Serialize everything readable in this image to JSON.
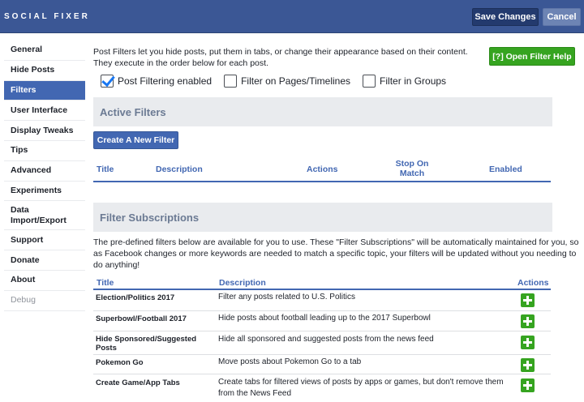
{
  "header": {
    "brand": "SOCIAL FIXER",
    "save_label": "Save Changes",
    "cancel_label": "Cancel"
  },
  "sidebar": {
    "items": [
      {
        "label": "General"
      },
      {
        "label": "Hide Posts"
      },
      {
        "label": "Filters"
      },
      {
        "label": "User Interface"
      },
      {
        "label": "Display Tweaks"
      },
      {
        "label": "Tips"
      },
      {
        "label": "Advanced"
      },
      {
        "label": "Experiments"
      },
      {
        "label": "Data Import/Export"
      },
      {
        "label": "Support"
      },
      {
        "label": "Donate"
      },
      {
        "label": "About"
      },
      {
        "label": "Debug"
      }
    ],
    "active_index": 2
  },
  "main": {
    "intro": "Post Filters let you hide posts, put them in tabs, or change their appearance based on their content. They execute in the order below for each post.",
    "help_button": "[?] Open Filter Help",
    "checkboxes": [
      {
        "label": "Post Filtering enabled",
        "checked": true
      },
      {
        "label": "Filter on Pages/Timelines",
        "checked": false
      },
      {
        "label": "Filter in Groups",
        "checked": false
      }
    ],
    "active_filters": {
      "heading": "Active Filters",
      "create_button": "Create A New Filter",
      "columns": [
        "Title",
        "Description",
        "Actions",
        "Stop On Match",
        "Enabled"
      ]
    },
    "subscriptions": {
      "heading": "Filter Subscriptions",
      "intro": "The pre-defined filters below are available for you to use. These \"Filter Subscriptions\" will be automatically maintained for you, so as Facebook changes or more keywords are needed to match a specific topic, your filters will be updated without you needing to do anything!",
      "columns": [
        "Title",
        "Description",
        "Actions"
      ],
      "rows": [
        {
          "title": "Election/Politics 2017",
          "description": "Filter any posts related to U.S. Politics"
        },
        {
          "title": "Superbowl/Football 2017",
          "description": "Hide posts about football leading up to the 2017 Superbowl"
        },
        {
          "title": "Hide Sponsored/Suggested Posts",
          "description": "Hide all sponsored and suggested posts from the news feed"
        },
        {
          "title": "Pokemon Go",
          "description": "Move posts about Pokemon Go to a tab"
        },
        {
          "title": "Create Game/App Tabs",
          "description": "Create tabs for filtered views of posts by apps or games, but don't remove them from the News Feed"
        }
      ]
    }
  },
  "colors": {
    "header_bg": "#3b5795",
    "accent": "#4267b2",
    "green": "#36a420"
  }
}
